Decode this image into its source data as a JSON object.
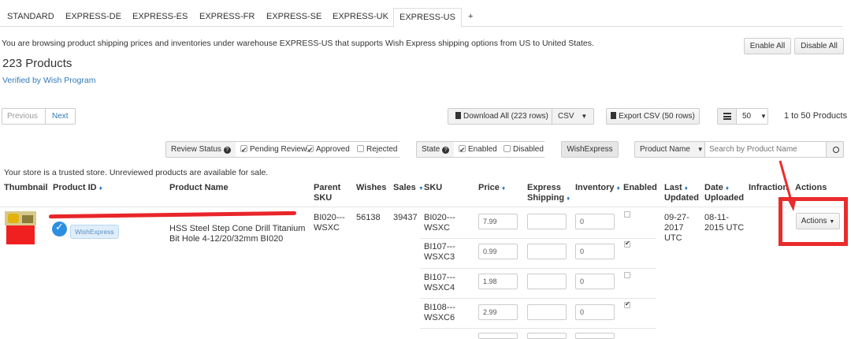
{
  "tabs": [
    "STANDARD",
    "EXPRESS-DE",
    "EXPRESS-ES",
    "EXPRESS-FR",
    "EXPRESS-SE",
    "EXPRESS-UK",
    "EXPRESS-US",
    "+"
  ],
  "info_text": "You are browsing product shipping prices and inventories under warehouse EXPRESS-US that supports Wish Express shipping options from US to United States.",
  "enable_all": "Enable All",
  "disable_all": "Disable All",
  "product_count": "223 Products",
  "verified_link": "Verified by Wish Program",
  "pagination": {
    "previous": "Previous",
    "next": "Next",
    "range": "1 to 50 Products"
  },
  "download": {
    "label": "Download All (223 rows)",
    "format": "CSV"
  },
  "export_label": "Export CSV (50 rows)",
  "page_size": "50",
  "filters": {
    "review_status_label": "Review Status",
    "pending_review": "Pending Review",
    "approved": "Approved",
    "rejected": "Rejected",
    "state_label": "State",
    "enabled": "Enabled",
    "disabled": "Disabled",
    "wishexpress": "WishExpress",
    "search_field": "Product Name",
    "search_placeholder": "Search by Product Name"
  },
  "trusted_note": "Your store is a trusted store. Unreviewed products are available for sale.",
  "columns": {
    "thumbnail": "Thumbnail",
    "product_id": "Product ID",
    "product_name": "Product Name",
    "parent_sku_1": "Parent",
    "parent_sku_2": "SKU",
    "wishes": "Wishes",
    "sales": "Sales",
    "sku": "SKU",
    "price": "Price",
    "express_1": "Express",
    "express_2": "Shipping",
    "inventory": "Inventory",
    "enabled": "Enabled",
    "last_1": "Last",
    "last_2": "Updated",
    "date_1": "Date",
    "date_2": "Uploaded",
    "infraction": "Infraction",
    "actions": "Actions"
  },
  "product": {
    "badge": "WishExpress",
    "name_line2": "HSS Steel Step Cone Drill Titanium",
    "name_line3": "Bit Hole 4-12/20/32mm BI020",
    "parent_sku_1": "BI020---",
    "parent_sku_2": "WSXC",
    "wishes": "56138",
    "sales": "39437",
    "last_updated": [
      "09-27-",
      "2017",
      "UTC"
    ],
    "date_uploaded": [
      "08-11-",
      "2015 UTC"
    ],
    "actions_button": "Actions"
  },
  "variants": [
    {
      "sku_1": "BI020---",
      "sku_2": "WSXC",
      "price": "7.99",
      "inventory": "0",
      "enabled": false
    },
    {
      "sku_1": "BI107---",
      "sku_2": "WSXC3",
      "price": "0.99",
      "inventory": "0",
      "enabled": true
    },
    {
      "sku_1": "BI107---",
      "sku_2": "WSXC4",
      "price": "1.98",
      "inventory": "0",
      "enabled": false
    },
    {
      "sku_1": "BI108---",
      "sku_2": "WSXC6",
      "price": "2.99",
      "inventory": "0",
      "enabled": true
    }
  ]
}
